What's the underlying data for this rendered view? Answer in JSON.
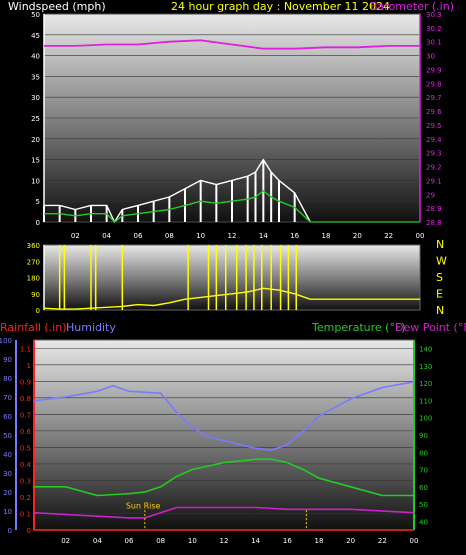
{
  "colors": {
    "barometer": "#e020e0",
    "wind": "#ffffff",
    "wind_avg": "#22cc22",
    "direction": "#ffff00",
    "humidity": "#7a7aff",
    "temperature": "#22cc22",
    "dewpoint": "#cc22cc",
    "rainfall": "#ff2222",
    "sun": "#ffcc00"
  },
  "header": {
    "windspeed_label": "Windspeed (mph)",
    "date_label": "24 hour graph day : November 11 2024",
    "barometer_label": "Barometer (.in)"
  },
  "lower_header": {
    "rainfall_label": "Rainfall (.in)",
    "humidity_label": "Humidity",
    "temperature_label": "Temperature (°F)",
    "dewpoint_label": "Dew Point (°F)"
  },
  "chart_data": [
    {
      "type": "line",
      "series": [
        {
          "name": "Windspeed (mph)",
          "x": [
            0,
            1,
            2,
            3,
            4,
            4.5,
            5,
            6,
            7,
            8,
            9,
            10,
            11,
            12,
            13,
            13.5,
            14,
            14.5,
            15,
            16,
            17
          ],
          "values": [
            4,
            4,
            3,
            4,
            4,
            0,
            3,
            4,
            5,
            6,
            8,
            10,
            9,
            10,
            11,
            12,
            15,
            12,
            10,
            7,
            0
          ]
        },
        {
          "name": "Barometer (.in)",
          "x": [
            0,
            2,
            4,
            6,
            8,
            10,
            12,
            14,
            16,
            18,
            20,
            22,
            24
          ],
          "values": [
            30.07,
            30.07,
            30.08,
            30.08,
            30.1,
            30.11,
            30.08,
            30.05,
            30.05,
            30.06,
            30.06,
            30.07,
            30.07
          ]
        }
      ],
      "x_ticks": [
        "02",
        "04",
        "06",
        "08",
        "10",
        "12",
        "14",
        "16",
        "18",
        "20",
        "22",
        "00"
      ],
      "y_left_ticks": [
        "0",
        "5",
        "10",
        "15",
        "20",
        "25",
        "30",
        "35",
        "40",
        "45",
        "50"
      ],
      "y_left_range": [
        0,
        50
      ],
      "y_right_ticks": [
        "28.8",
        "28.9",
        "29",
        "29.1",
        "29.2",
        "29.3",
        "29.4",
        "29.5",
        "29.6",
        "29.7",
        "29.8",
        "29.9",
        "30",
        "30.1",
        "30.2",
        "30.3"
      ],
      "y_right_range": [
        28.8,
        30.3
      ]
    },
    {
      "type": "line",
      "series": [
        {
          "name": "Wind direction",
          "x": [
            0,
            1,
            2,
            3,
            4,
            5,
            6,
            7,
            8,
            9,
            10,
            11,
            12,
            13,
            14,
            15,
            16,
            17,
            24
          ],
          "values": [
            10,
            5,
            5,
            10,
            15,
            20,
            30,
            25,
            40,
            60,
            70,
            80,
            90,
            100,
            120,
            110,
            90,
            60,
            60
          ]
        }
      ],
      "y_left_ticks": [
        "0",
        "90",
        "180",
        "270",
        "360"
      ],
      "y_left_range": [
        0,
        360
      ],
      "compass_labels": [
        "N",
        "W",
        "S",
        "E",
        "N"
      ]
    },
    {
      "type": "line",
      "series": [
        {
          "name": "Humidity",
          "x": [
            0,
            2,
            4,
            5,
            6,
            8,
            9,
            10,
            11,
            12,
            13,
            14,
            15,
            16,
            17,
            18,
            20,
            22,
            24
          ],
          "values": [
            68,
            70,
            73,
            76,
            73,
            72,
            62,
            54,
            49,
            47,
            45,
            43,
            42,
            45,
            52,
            60,
            69,
            75,
            78
          ]
        },
        {
          "name": "Temperature (°F)",
          "x": [
            0,
            2,
            4,
            6,
            7,
            8,
            9,
            10,
            12,
            13,
            14,
            15,
            16,
            17,
            18,
            20,
            22,
            24
          ],
          "values": [
            60,
            60,
            55,
            56,
            57,
            60,
            66,
            70,
            74,
            75,
            76,
            76,
            74,
            70,
            65,
            60,
            55,
            55
          ]
        },
        {
          "name": "Dew Point (°F)",
          "x": [
            0,
            2,
            4,
            6,
            7,
            8,
            9,
            10,
            12,
            14,
            16,
            18,
            20,
            22,
            24
          ],
          "values": [
            45,
            44,
            43,
            42,
            42,
            45,
            48,
            48,
            48,
            48,
            47,
            47,
            47,
            46,
            45
          ]
        },
        {
          "name": "Rainfall (.in)",
          "x": [
            0,
            24
          ],
          "values": [
            0,
            0
          ]
        }
      ],
      "annotations": [
        "Sun Rise"
      ],
      "x_ticks": [
        "02",
        "04",
        "06",
        "08",
        "10",
        "12",
        "14",
        "16",
        "18",
        "20",
        "22",
        "00"
      ],
      "y_left_outer_ticks": [
        "0",
        "10",
        "20",
        "30",
        "40",
        "50",
        "60",
        "70",
        "80",
        "90",
        "100"
      ],
      "y_left_outer_range": [
        0,
        100
      ],
      "y_left_inner_ticks": [
        "0",
        "0.1",
        "0.2",
        "0.3",
        "0.4",
        "0.5",
        "0.6",
        "0.7",
        "0.8",
        "0.9",
        "1",
        "1.1"
      ],
      "y_left_inner_range": [
        0,
        1.15
      ],
      "y_right_ticks": [
        "40",
        "50",
        "60",
        "70",
        "80",
        "90",
        "100",
        "110",
        "120",
        "130",
        "140"
      ],
      "y_right_range": [
        35,
        145
      ]
    }
  ]
}
